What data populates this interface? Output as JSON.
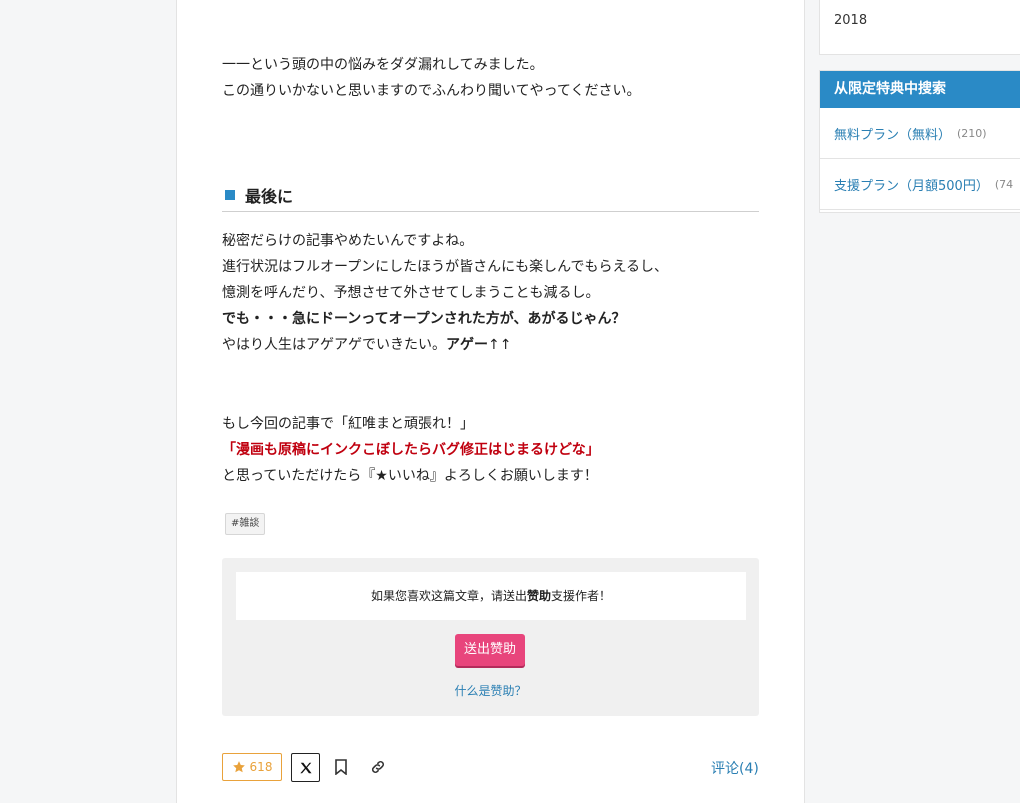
{
  "article": {
    "intro_lines": [
      "一一という頭の中の悩みをダダ漏れしてみました。",
      "この通りいかないと思いますのでふんわり聞いてやってください。"
    ],
    "section_heading": "最後に",
    "body": {
      "line1": "秘密だらけの記事やめたいんですよね。",
      "line2": "進行状況はフルオープンにしたほうが皆さんにも楽しんでもらえるし、",
      "line3": "憶測を呼んだり、予想させて外させてしまうことも減るし。",
      "line4": "でも・・・急にドーンってオープンされた方が、あがるじゃん？",
      "line5_a": "やはり人生はアゲアゲでいきたい。",
      "line5_b": "アゲー",
      "line5_c": "↑↑"
    },
    "closing": {
      "line1": "もし今回の記事で「紅唯まと頑張れ！」",
      "line2": "「漫画も原稿にインクこぼしたらバグ修正はじまるけどな」",
      "line3": "と思っていただけたら『★いいね』よろしくお願いします！"
    },
    "tag": "#雑談",
    "support": {
      "message_prefix": "如果您喜欢这篇文章，请送出",
      "message_bold": "赞助",
      "message_suffix": "支援作者！",
      "button_label": "送出赞助",
      "what_link": "什么是赞助？"
    },
    "actions": {
      "like_count": "618",
      "comments_label": "评论(4)"
    }
  },
  "sidebar": {
    "year_item": "2018",
    "search_title": "从限定特典中搜索",
    "plans": [
      {
        "label": "無料プラン（無料）",
        "count": "(210)"
      },
      {
        "label": "支援プラン（月額500円）",
        "count": "(74"
      }
    ]
  },
  "colors": {
    "accent_blue": "#2a8ac6",
    "support_pink": "#e8457c",
    "highlight_red": "#c0000f",
    "like_orange": "#e9a23b"
  }
}
